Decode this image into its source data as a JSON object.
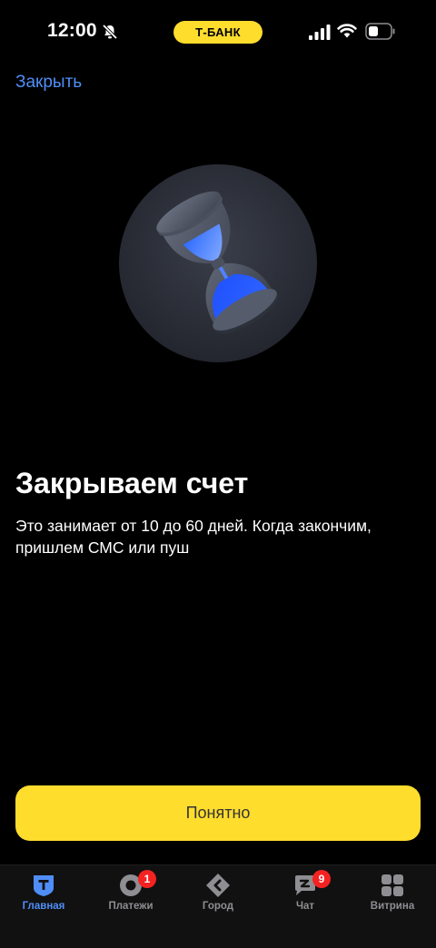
{
  "status_bar": {
    "time": "12:00",
    "bank_label": "Т-БАНК",
    "icons": [
      "bell-off-icon",
      "signal-icon",
      "wifi-icon",
      "battery-icon"
    ]
  },
  "header": {
    "close_label": "Закрыть"
  },
  "illustration": {
    "icon": "hourglass-icon"
  },
  "content": {
    "title": "Закрываем счет",
    "description": "Это занимает от 10 до 60 дней. Когда закончим, пришлем СМС или пуш"
  },
  "actions": {
    "primary_label": "Понятно"
  },
  "tab_bar": {
    "items": [
      {
        "label": "Главная",
        "icon": "home-t-icon",
        "active": true,
        "badge": ""
      },
      {
        "label": "Платежи",
        "icon": "payments-icon",
        "active": false,
        "badge": "1"
      },
      {
        "label": "Город",
        "icon": "city-icon",
        "active": false,
        "badge": ""
      },
      {
        "label": "Чат",
        "icon": "chat-icon",
        "active": false,
        "badge": "9"
      },
      {
        "label": "Витрина",
        "icon": "showcase-icon",
        "active": false,
        "badge": ""
      }
    ]
  },
  "colors": {
    "accent_yellow": "#FFDD2D",
    "link_blue": "#4F8EF7",
    "badge_red": "#F52222",
    "background": "#000000"
  }
}
